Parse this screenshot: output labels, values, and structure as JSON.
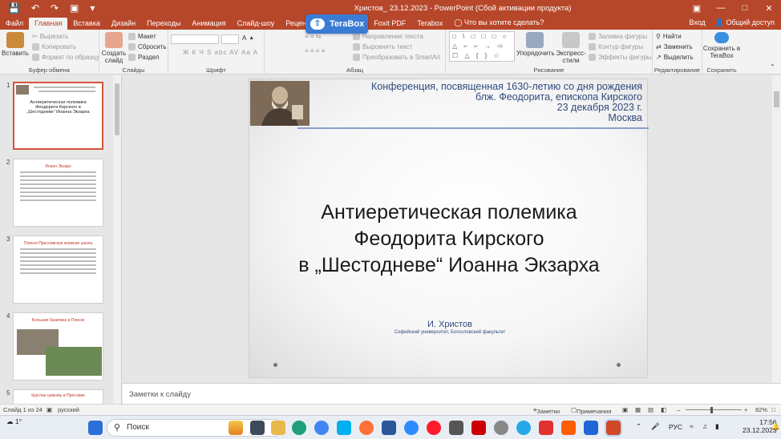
{
  "window": {
    "title": "Христов_ 23.12.2023 - PowerPoint (Сбой активации продукта)"
  },
  "tabs": [
    "Файл",
    "Главная",
    "Вставка",
    "Дизайн",
    "Переходы",
    "Анимация",
    "Слайд-шоу",
    "Рецензирование",
    "ent",
    "Foxit PDF",
    "Terabox"
  ],
  "tell_me": "Что вы хотите сделать?",
  "account": {
    "signin": "Вход",
    "share": "Общий доступ"
  },
  "terabox_badge": "TeraBox",
  "ribbon": {
    "clipboard": {
      "label": "Буфер обмена",
      "paste": "Вставить",
      "cut": "Вырезать",
      "copy": "Копировать",
      "format": "Формат по образцу"
    },
    "slides": {
      "label": "Слайды",
      "new": "Создать слайд",
      "layout": "Макет",
      "reset": "Сбросить",
      "section": "Раздел"
    },
    "font": {
      "label": "Шрифт",
      "buttons": "Ж К Ч S abc AV Aa A"
    },
    "paragraph": {
      "label": "Абзац",
      "dir": "Направление текста",
      "align": "Выровнять текст",
      "smartart": "Преобразовать в SmartArt"
    },
    "drawing": {
      "label": "Рисование",
      "arrange": "Упорядочить",
      "styles": "Экспресс-стили",
      "fill": "Заливка фигуры",
      "outline": "Контур фигуры",
      "effects": "Эффекты фигуры"
    },
    "editing": {
      "label": "Редактирование",
      "find": "Найти",
      "replace": "Заменить",
      "select": "Выделить"
    },
    "save": {
      "label": "Сохранить",
      "button": "Сохранить в TeraBox"
    }
  },
  "thumbnails": [
    {
      "num": "1",
      "title": "Антиеретическая полемика Феодорита Кирского в „Шестодневе“ Иоанна Экзарха"
    },
    {
      "num": "2",
      "title": "Иоанн Экзарх"
    },
    {
      "num": "3",
      "title": "Плиско-Преславская книжная школа"
    },
    {
      "num": "4",
      "title": "Большая базилика в Плиске"
    },
    {
      "num": "5",
      "title": "Круглая церковь в Преславе"
    }
  ],
  "slide": {
    "conference": [
      "Конференция, посвященная 1630-летию со дня рождения",
      "блж. Феодорита, епископа Кирского",
      "23 декабря 2023 г.",
      "Москва"
    ],
    "title": [
      "Антиеретическая полемика",
      "Феодорита Кирского",
      "в „Шестодневе“ Иоанна Экзарха"
    ],
    "author": "И. Христов",
    "affiliation": "Софийский университет, Богословский факультет"
  },
  "notes_placeholder": "Заметки к слайду",
  "status": {
    "slide": "Слайд 1 из 24",
    "lang": "русский",
    "notes": "Заметки",
    "comments": "Примечания",
    "zoom": "82%"
  },
  "taskbar": {
    "weather": "1°",
    "search": "Поиск",
    "lang": "РУС",
    "time": "17:56",
    "date": "23.12.2023"
  }
}
